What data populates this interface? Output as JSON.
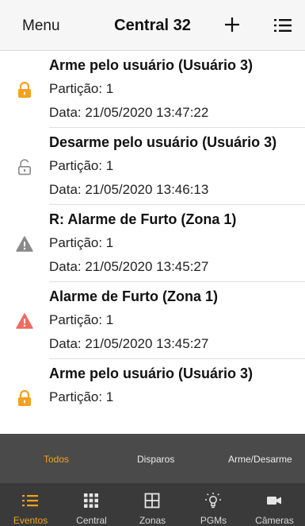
{
  "navbar": {
    "menu_label": "Menu",
    "title": "Central 32"
  },
  "events": [
    {
      "icon": "lock-closed-icon",
      "title": "Arme pelo usuário  (Usuário 3)",
      "partition": "Partição: 1",
      "date": "Data: 21/05/2020 13:47:22"
    },
    {
      "icon": "lock-open-icon",
      "title": "Desarme pelo usuário  (Usuário 3)",
      "partition": "Partição: 1",
      "date": "Data: 21/05/2020 13:46:13"
    },
    {
      "icon": "warning-gray-icon",
      "title": "R: Alarme de Furto  (Zona 1)",
      "partition": "Partição: 1",
      "date": "Data: 21/05/2020 13:45:27"
    },
    {
      "icon": "warning-red-icon",
      "title": "Alarme de Furto  (Zona 1)",
      "partition": "Partição: 1",
      "date": "Data: 21/05/2020 13:45:27"
    },
    {
      "icon": "lock-closed-icon",
      "title": "Arme pelo usuário  (Usuário 3)",
      "partition": "Partição: 1",
      "date": ""
    }
  ],
  "filters": {
    "all": "Todos",
    "triggers": "Disparos",
    "arm_disarm": "Arme/Desarme"
  },
  "tabs": {
    "events": "Eventos",
    "central": "Central",
    "zones": "Zonas",
    "pgms": "PGMs",
    "cameras": "Câmeras"
  },
  "colors": {
    "accent": "#f5a020",
    "alarm": "#ee6b62",
    "warning_gray": "#8a8a8a",
    "filterbar": "#4a4a4a",
    "tabbar": "#3a3a3a"
  }
}
